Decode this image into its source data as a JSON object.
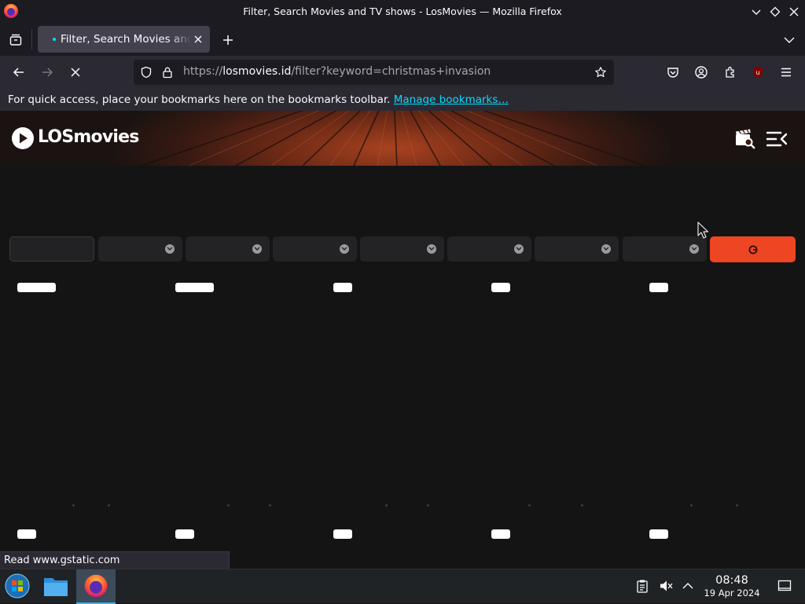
{
  "window": {
    "title": "Filter, Search Movies and TV shows - LosMovies — Mozilla Firefox"
  },
  "tab": {
    "title": "Filter, Search Movies and TV shows - LosMovies"
  },
  "urlbar": {
    "scheme": "https://",
    "host": "losmovies.id",
    "path": "/filter?keyword=christmas+invasion"
  },
  "extensions": {
    "badge_count": "3"
  },
  "bookmarks_bar": {
    "message": "For quick access, place your bookmarks here on the bookmarks toolbar.",
    "manage_link": "Manage bookmarks…"
  },
  "site": {
    "logo_text": "LOSmovies",
    "accent_color": "#ee4522"
  },
  "filters": {
    "keyword_placeholder": "",
    "dropdowns": [
      "",
      "",
      "",
      "",
      "",
      "",
      ""
    ]
  },
  "status_bar": {
    "text": "Read www.gstatic.com"
  },
  "taskbar": {
    "time": "08:48",
    "date": "19 Apr 2024"
  },
  "icons": [
    "firefox-icon",
    "minimize-icon",
    "maximize-icon",
    "close-icon",
    "list-all-tabs-icon",
    "tab-close-icon",
    "new-tab-icon",
    "back-icon",
    "forward-icon",
    "stop-loading-icon",
    "tracking-shield-icon",
    "lock-icon",
    "bookmark-star-icon",
    "pocket-icon",
    "account-icon",
    "extensions-icon",
    "ublock-icon",
    "menu-icon",
    "movie-search-icon",
    "menu-toggle-icon",
    "reset-filter-icon",
    "start-menu-icon",
    "file-manager-icon",
    "clipboard-icon",
    "volume-muted-icon",
    "tray-expand-icon",
    "show-desktop-icon"
  ]
}
